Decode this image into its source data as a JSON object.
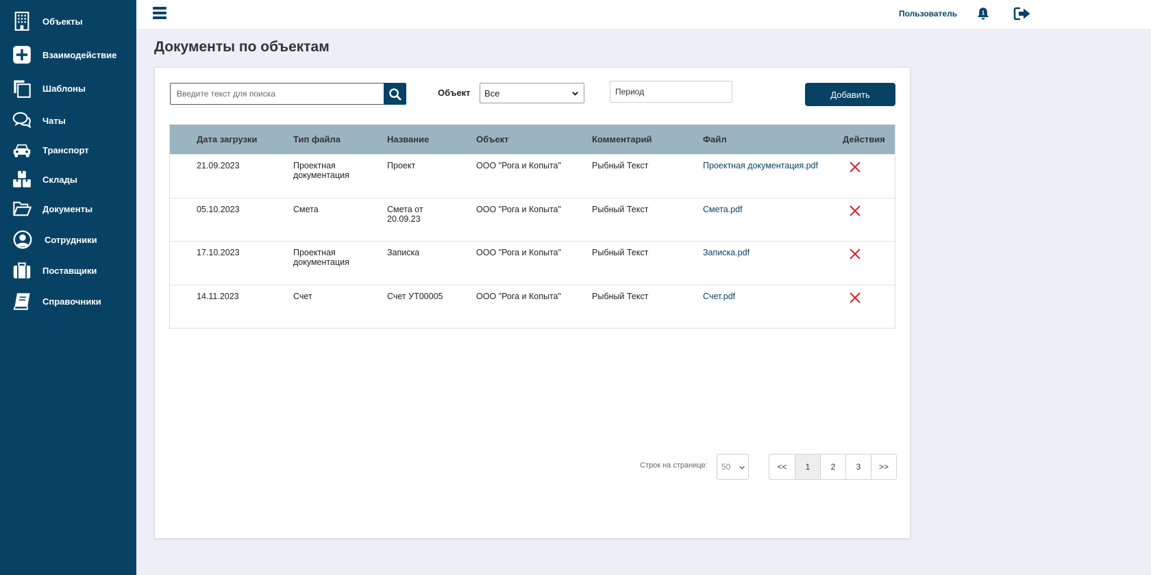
{
  "sidebar": {
    "items": [
      {
        "label": "Объекты",
        "icon": "building-icon"
      },
      {
        "label": "Взаимодействие",
        "icon": "plus-square-icon"
      },
      {
        "label": "Шаблоны",
        "icon": "copy-icon"
      },
      {
        "label": "Чаты",
        "icon": "chat-icon"
      },
      {
        "label": "Транспорт",
        "icon": "car-icon"
      },
      {
        "label": "Склады",
        "icon": "boxes-icon"
      },
      {
        "label": "Документы",
        "icon": "folder-open-icon"
      },
      {
        "label": "Сотрудники",
        "icon": "user-circle-icon"
      },
      {
        "label": "Поставщики",
        "icon": "briefcase-icon"
      },
      {
        "label": "Справочники",
        "icon": "book-icon"
      }
    ]
  },
  "topbar": {
    "user_label": "Пользователь",
    "notification_count": "1"
  },
  "page": {
    "title": "Документы по объектам"
  },
  "filters": {
    "search_placeholder": "Введите текст для поиска",
    "object_label": "Объект",
    "object_value": "Все",
    "period_placeholder": "Период",
    "add_label": "Добавить"
  },
  "table": {
    "headers": [
      "Дата загрузки",
      "Тип файла",
      "Название",
      "Объект",
      "Комментарий",
      "Файл",
      "Действия"
    ],
    "rows": [
      {
        "date": "21.09.2023",
        "type_line1": "Проектная",
        "type_line2": "документация",
        "name_line1": "Проект",
        "name_line2": "",
        "object": "ООО \"Рога и Копыта\"",
        "comment": "Рыбный Текст",
        "file": "Проектная документация.pdf"
      },
      {
        "date": "05.10.2023",
        "type_line1": "Смета",
        "type_line2": "",
        "name_line1": "Смета от",
        "name_line2": "20.09.23",
        "object": "ООО \"Рога и Копыта\"",
        "comment": "Рыбный Текст",
        "file": "Смета.pdf"
      },
      {
        "date": "17.10.2023",
        "type_line1": "Проектная",
        "type_line2": "документация",
        "name_line1": "Записка",
        "name_line2": "",
        "object": "ООО \"Рога и Копыта\"",
        "comment": "Рыбный Текст",
        "file": "Записка.pdf"
      },
      {
        "date": "14.11.2023",
        "type_line1": "Счет",
        "type_line2": "",
        "name_line1": "Счет УТ00005",
        "name_line2": "",
        "object": "ООО \"Рога и Копыта\"",
        "comment": "Рыбный Текст",
        "file": "Счет.pdf"
      }
    ]
  },
  "pagination": {
    "rows_label": "Строк на странице:",
    "rows_value": "50",
    "first": "<<",
    "pages": [
      "1",
      "2",
      "3"
    ],
    "last": ">>",
    "current_page": "1"
  },
  "colors": {
    "brand": "#074264",
    "header_row": "#9ab4c2",
    "delete": "#d9232a",
    "background": "#eeeff6"
  }
}
